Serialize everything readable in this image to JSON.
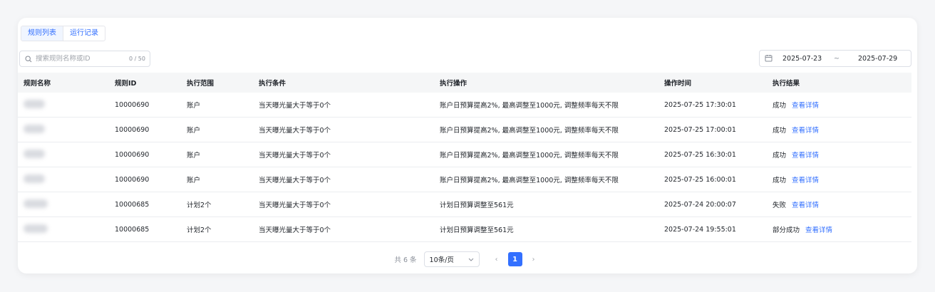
{
  "tabs": [
    {
      "label": "规则列表"
    },
    {
      "label": "运行记录"
    }
  ],
  "search": {
    "placeholder": "搜索规则名称或ID",
    "count": "0 / 50"
  },
  "date_range": {
    "start": "2025-07-23",
    "separator": "~",
    "end": "2025-07-29"
  },
  "table": {
    "headers": [
      "规则名称",
      "规则ID",
      "执行范围",
      "执行条件",
      "执行操作",
      "操作时间",
      "执行结果"
    ],
    "rows": [
      {
        "id": "10000690",
        "scope": "账户",
        "condition": "当天曝光量大于等于0个",
        "action": "账户日预算提高2%, 最高调整至1000元, 调整频率每天不限",
        "time": "2025-07-25 17:30:01",
        "result": "成功",
        "detail": "查看详情"
      },
      {
        "id": "10000690",
        "scope": "账户",
        "condition": "当天曝光量大于等于0个",
        "action": "账户日预算提高2%, 最高调整至1000元, 调整频率每天不限",
        "time": "2025-07-25 17:00:01",
        "result": "成功",
        "detail": "查看详情"
      },
      {
        "id": "10000690",
        "scope": "账户",
        "condition": "当天曝光量大于等于0个",
        "action": "账户日预算提高2%, 最高调整至1000元, 调整频率每天不限",
        "time": "2025-07-25 16:30:01",
        "result": "成功",
        "detail": "查看详情"
      },
      {
        "id": "10000690",
        "scope": "账户",
        "condition": "当天曝光量大于等于0个",
        "action": "账户日预算提高2%, 最高调整至1000元, 调整频率每天不限",
        "time": "2025-07-25 16:00:01",
        "result": "成功",
        "detail": "查看详情"
      },
      {
        "id": "10000685",
        "scope": "计划2个",
        "condition": "当天曝光量大于等于0个",
        "action": "计划日预算调整至561元",
        "time": "2025-07-24 20:00:07",
        "result": "失败",
        "detail": "查看详情"
      },
      {
        "id": "10000685",
        "scope": "计划2个",
        "condition": "当天曝光量大于等于0个",
        "action": "计划日预算调整至561元",
        "time": "2025-07-24 19:55:01",
        "result": "部分成功",
        "detail": "查看详情"
      }
    ]
  },
  "pagination": {
    "total": "共 6 条",
    "page_size": "10条/页",
    "current_page": "1",
    "prev": "‹",
    "next": "›"
  },
  "colors": {
    "accent": "#3370ff",
    "header_bg": "#f5f6f7"
  }
}
